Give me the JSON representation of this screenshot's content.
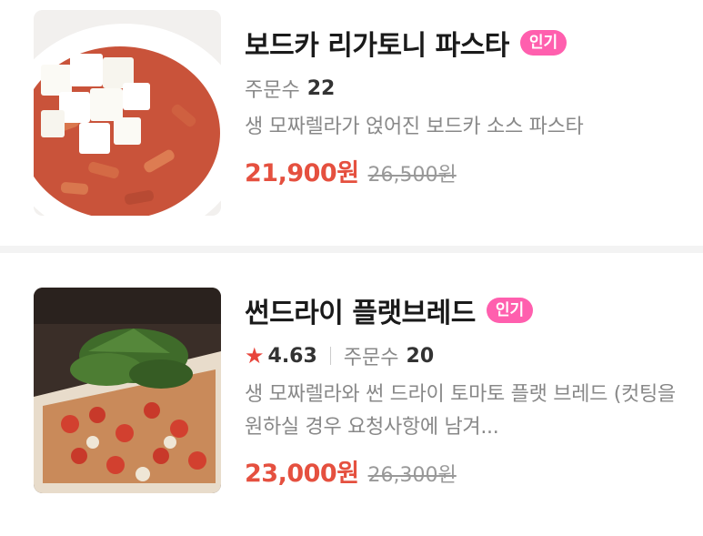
{
  "menu_items": [
    {
      "name": "보드카 리가토니 파스타",
      "badge": "인기",
      "order_label": "주문수",
      "order_count": "22",
      "description": "생 모짜렐라가 얹어진 보드카 소스 파스타",
      "price": "21,900원",
      "original_price": "26,500원"
    },
    {
      "name": "썬드라이 플랫브레드",
      "badge": "인기",
      "rating": "4.63",
      "order_label": "주문수",
      "order_count": "20",
      "description": "생 모짜렐라와 썬 드라이 토마토 플랫 브레드 (컷팅을 원하실 경우 요청사항에 남겨...",
      "price": "23,000원",
      "original_price": "26,300원"
    }
  ],
  "colors": {
    "badge": "#ff5fae",
    "price": "#e5503f",
    "star": "#e8453c"
  }
}
